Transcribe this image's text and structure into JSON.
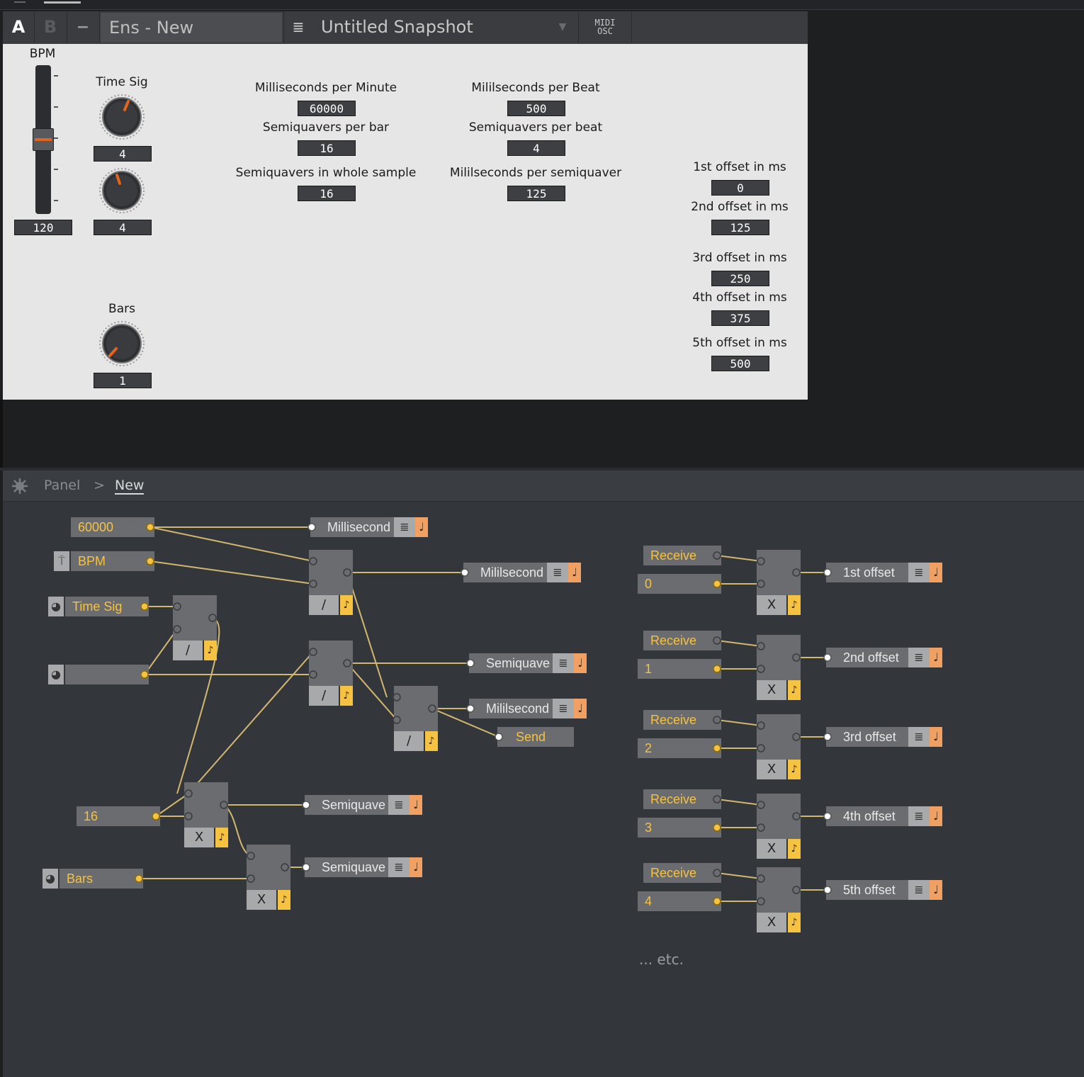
{
  "toolbar": {
    "btn_a": "A",
    "btn_b": "B",
    "btn_minus": "−",
    "ens_name": "Ens - New",
    "snapshot": "Untitled Snapshot",
    "midi_top": "MIDI",
    "midi_bottom": "OSC"
  },
  "panel": {
    "bpm_label": "BPM",
    "bpm_value": "120",
    "bpm_level": 0.5,
    "timesig_label": "Time Sig",
    "timesig_num": "4",
    "timesig_den": "4",
    "bars_label": "Bars",
    "bars_value": "1",
    "ms_per_minute_label": "Milliseconds per Minute",
    "ms_per_minute": "60000",
    "ms_per_beat_label": "Mililseconds per Beat",
    "ms_per_beat": "500",
    "sq_per_bar_label": "Semiquavers per bar",
    "sq_per_bar": "16",
    "sq_per_beat_label": "Semiquavers per beat",
    "sq_per_beat": "4",
    "sq_whole_label": "Semiquavers in whole sample",
    "sq_whole": "16",
    "ms_per_sq_label": "Mililseconds per semiquaver",
    "ms_per_sq": "125",
    "offsets": [
      {
        "label": "1st offset in ms",
        "value": "0"
      },
      {
        "label": "2nd offset in ms",
        "value": "125"
      },
      {
        "label": "3rd offset in ms",
        "value": "250"
      },
      {
        "label": "4th offset in ms",
        "value": "375"
      },
      {
        "label": "5th offset in ms",
        "value": "500"
      }
    ]
  },
  "breadcrumb": {
    "root": "Panel",
    "sep": ">",
    "current": "New"
  },
  "editor": {
    "const_60000": "60000",
    "bpm_mod": "BPM",
    "timesig_mod": "Time Sig",
    "blank_knob_mod": "",
    "const_16": "16",
    "bars_mod": "Bars",
    "out_ms_minute": "Millisecond",
    "out_ms_beat": "Mililsecond",
    "out_sq_beat": "Semiquave",
    "out_ms_sq": "Mililsecond",
    "send": "Send",
    "out_sq_bar": "Semiquave",
    "out_sq_whole": "Semiquave",
    "op_div": "/",
    "op_mul": "X",
    "trig": "♪",
    "list_icon": "≣",
    "note_icon": "♩",
    "receive": "Receive",
    "offset_consts": [
      "0",
      "1",
      "2",
      "3",
      "4"
    ],
    "offset_outs": [
      "1st offset",
      "2nd offset",
      "3rd offset",
      "4th offset",
      "5th offset"
    ],
    "etc": "... etc."
  },
  "colors": {
    "wire": "#d2b76e",
    "port": "#f5c242",
    "module": "#6a6c6f",
    "panel_bg": "#e6e6e6",
    "editor_bg": "#33373b"
  }
}
